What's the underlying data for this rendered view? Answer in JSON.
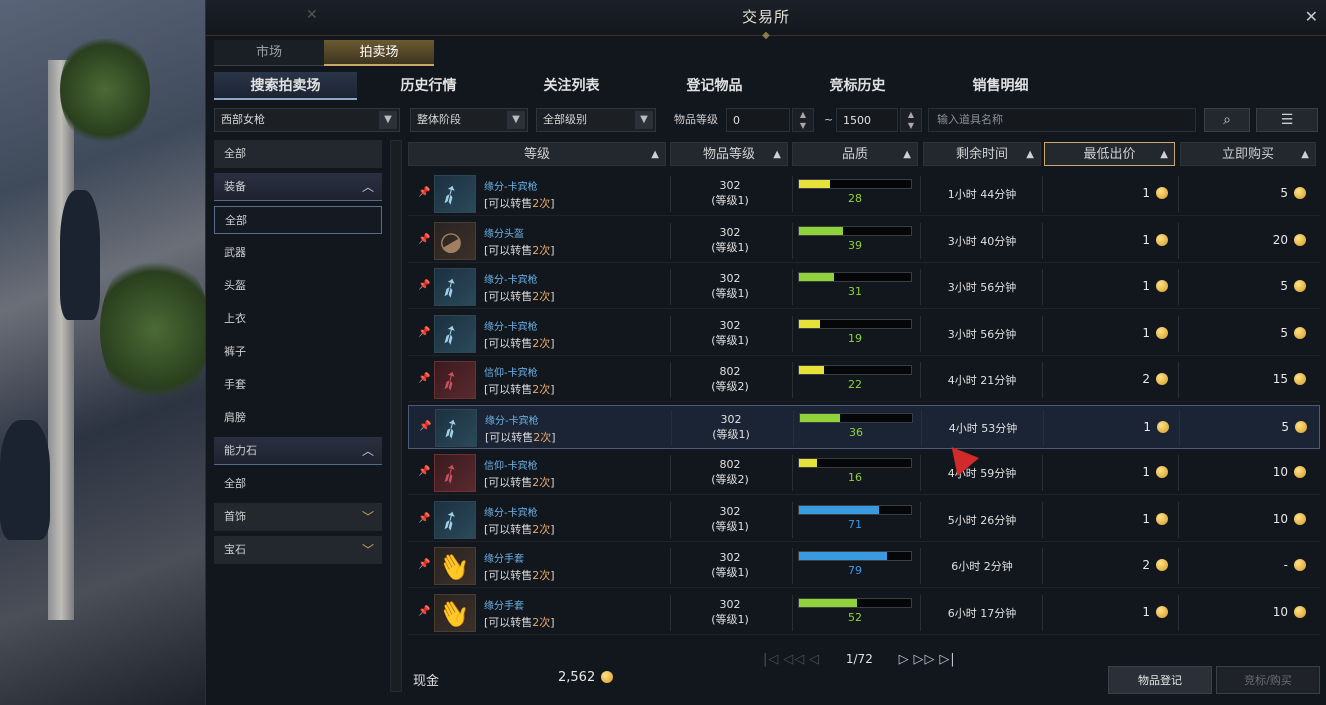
{
  "window": {
    "title": "交易所"
  },
  "top_tabs": [
    {
      "label": "市场",
      "active": false
    },
    {
      "label": "拍卖场",
      "active": true
    }
  ],
  "sub_tabs": [
    {
      "label": "搜索拍卖场",
      "active": true
    },
    {
      "label": "历史行情",
      "active": false
    },
    {
      "label": "关注列表",
      "active": false
    },
    {
      "label": "登记物品",
      "active": false
    },
    {
      "label": "竞标历史",
      "active": false
    },
    {
      "label": "销售明细",
      "active": false
    }
  ],
  "filters": {
    "class": "西部女枪",
    "tier": "整体阶段",
    "grade": "全部级别",
    "item_level_label": "物品等级",
    "item_level_min": "0",
    "item_level_tilde": "~",
    "item_level_max": "1500",
    "search_placeholder": "输入道具名称"
  },
  "sidebar": {
    "items": [
      {
        "label": "全部",
        "type": "cat"
      },
      {
        "label": "装备",
        "type": "cat-open"
      },
      {
        "label": "全部",
        "type": "selected"
      },
      {
        "label": "武器",
        "type": "sub"
      },
      {
        "label": "头盔",
        "type": "sub"
      },
      {
        "label": "上衣",
        "type": "sub"
      },
      {
        "label": "裤子",
        "type": "sub"
      },
      {
        "label": "手套",
        "type": "sub"
      },
      {
        "label": "肩膀",
        "type": "sub"
      },
      {
        "label": "能力石",
        "type": "cat-open"
      },
      {
        "label": "全部",
        "type": "sub"
      },
      {
        "label": "首饰",
        "type": "cat"
      },
      {
        "label": "宝石",
        "type": "cat"
      }
    ]
  },
  "table": {
    "headers": [
      "等级",
      "物品等级",
      "品质",
      "剩余时间",
      "最低出价",
      "立即购买"
    ],
    "rows": [
      {
        "name": "缘分-卡宾枪",
        "resell_prefix": "[可以转售",
        "resell_count": "2次",
        "resell_suffix": "]",
        "ilvl": "302",
        "tier": "(等级1)",
        "quality": 28,
        "time": "1小时 44分钟",
        "min_bid": "1",
        "buy_now": "5",
        "icon": "rifle",
        "highlight": false
      },
      {
        "name": "缘分头盔",
        "resell_prefix": "[可以转售",
        "resell_count": "2次",
        "resell_suffix": "]",
        "ilvl": "302",
        "tier": "(等级1)",
        "quality": 39,
        "time": "3小时 40分钟",
        "min_bid": "1",
        "buy_now": "20",
        "icon": "helmet",
        "highlight": false
      },
      {
        "name": "缘分-卡宾枪",
        "resell_prefix": "[可以转售",
        "resell_count": "2次",
        "resell_suffix": "]",
        "ilvl": "302",
        "tier": "(等级1)",
        "quality": 31,
        "time": "3小时 56分钟",
        "min_bid": "1",
        "buy_now": "5",
        "icon": "rifle",
        "highlight": false
      },
      {
        "name": "缘分-卡宾枪",
        "resell_prefix": "[可以转售",
        "resell_count": "2次",
        "resell_suffix": "]",
        "ilvl": "302",
        "tier": "(等级1)",
        "quality": 19,
        "time": "3小时 56分钟",
        "min_bid": "1",
        "buy_now": "5",
        "icon": "rifle",
        "highlight": false
      },
      {
        "name": "信仰-卡宾枪",
        "resell_prefix": "[可以转售",
        "resell_count": "2次",
        "resell_suffix": "]",
        "ilvl": "802",
        "tier": "(等级2)",
        "quality": 22,
        "time": "4小时 21分钟",
        "min_bid": "2",
        "buy_now": "15",
        "icon": "rifle-red",
        "highlight": false
      },
      {
        "name": "缘分-卡宾枪",
        "resell_prefix": "[可以转售",
        "resell_count": "2次",
        "resell_suffix": "]",
        "ilvl": "302",
        "tier": "(等级1)",
        "quality": 36,
        "time": "4小时 53分钟",
        "min_bid": "1",
        "buy_now": "5",
        "icon": "rifle",
        "highlight": true
      },
      {
        "name": "信仰-卡宾枪",
        "resell_prefix": "[可以转售",
        "resell_count": "2次",
        "resell_suffix": "]",
        "ilvl": "802",
        "tier": "(等级2)",
        "quality": 16,
        "time": "4小时 59分钟",
        "min_bid": "1",
        "buy_now": "10",
        "icon": "rifle-red",
        "highlight": false
      },
      {
        "name": "缘分-卡宾枪",
        "resell_prefix": "[可以转售",
        "resell_count": "2次",
        "resell_suffix": "]",
        "ilvl": "302",
        "tier": "(等级1)",
        "quality": 71,
        "time": "5小时 26分钟",
        "min_bid": "1",
        "buy_now": "10",
        "icon": "rifle",
        "highlight": false
      },
      {
        "name": "缘分手套",
        "resell_prefix": "[可以转售",
        "resell_count": "2次",
        "resell_suffix": "]",
        "ilvl": "302",
        "tier": "(等级1)",
        "quality": 79,
        "time": "6小时 2分钟",
        "min_bid": "2",
        "buy_now": "-",
        "icon": "gloves",
        "highlight": false
      },
      {
        "name": "缘分手套",
        "resell_prefix": "[可以转售",
        "resell_count": "2次",
        "resell_suffix": "]",
        "ilvl": "302",
        "tier": "(等级1)",
        "quality": 52,
        "time": "6小时 17分钟",
        "min_bid": "1",
        "buy_now": "10",
        "icon": "gloves",
        "highlight": false
      }
    ]
  },
  "pagination": {
    "label": "1/72"
  },
  "footer": {
    "cash_label": "现金",
    "cash_value": "2,562",
    "register_button": "物品登记",
    "bid_buy_button": "竞标/购买"
  },
  "colors": {
    "quality_yellow": "#e6e23a",
    "quality_green": "#8fd23a",
    "quality_blue": "#3a9ae0",
    "quality_text_green": "#8fd23a",
    "quality_text_blue": "#3a9ae0",
    "accent_gold": "#c9a96a"
  }
}
